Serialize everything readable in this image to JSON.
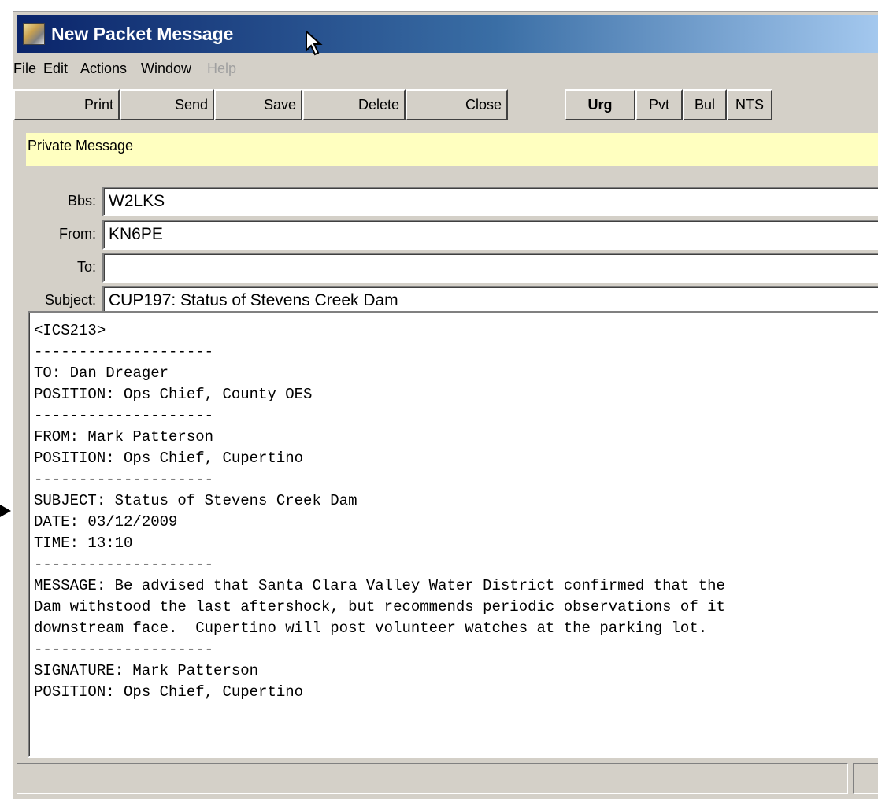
{
  "window": {
    "title": "New Packet Message",
    "minimize_glyph": "-"
  },
  "menu": {
    "items": [
      "File",
      "Edit",
      "Actions",
      "Window",
      "Help"
    ],
    "disabled": [
      "Help"
    ]
  },
  "toolbar": {
    "print": "Print",
    "send": "Send",
    "save": "Save",
    "delete": "Delete",
    "close": "Close",
    "urg": "Urg",
    "pvt": "Pvt",
    "bul": "Bul",
    "nts": "NTS"
  },
  "banner": {
    "text": "Private Message",
    "color": "#ffffc0"
  },
  "fields": {
    "bbs": {
      "label": "Bbs:",
      "value": "W2LKS"
    },
    "from": {
      "label": "From:",
      "value": "KN6PE"
    },
    "to": {
      "label": "To:",
      "value": ""
    },
    "subject": {
      "label": "Subject:",
      "value": "CUP197: Status of Stevens Creek Dam"
    }
  },
  "body_lines": [
    "<ICS213>",
    "--------------------",
    "TO: Dan Dreager",
    "POSITION: Ops Chief, County OES",
    "--------------------",
    "FROM: Mark Patterson",
    "POSITION: Ops Chief, Cupertino",
    "--------------------",
    "SUBJECT: Status of Stevens Creek Dam",
    "DATE: 03/12/2009",
    "TIME: 13:10",
    "--------------------",
    "MESSAGE: Be advised that Santa Clara Valley Water District confirmed that the",
    "Dam withstood the last aftershock, but recommends periodic observations of it",
    "downstream face.  Cupertino will post volunteer watches at the parking lot.",
    "--------------------",
    "SIGNATURE: Mark Patterson",
    "POSITION: Ops Chief, Cupertino"
  ],
  "colors": {
    "title_gradient_start": "#0a246a",
    "title_gradient_end": "#a6caf0",
    "face": "#d4d0c8"
  },
  "icons": {
    "app": "packet-app-icon",
    "cursor": "mouse-pointer-icon",
    "pointer": "arrow-pointer-icon"
  }
}
